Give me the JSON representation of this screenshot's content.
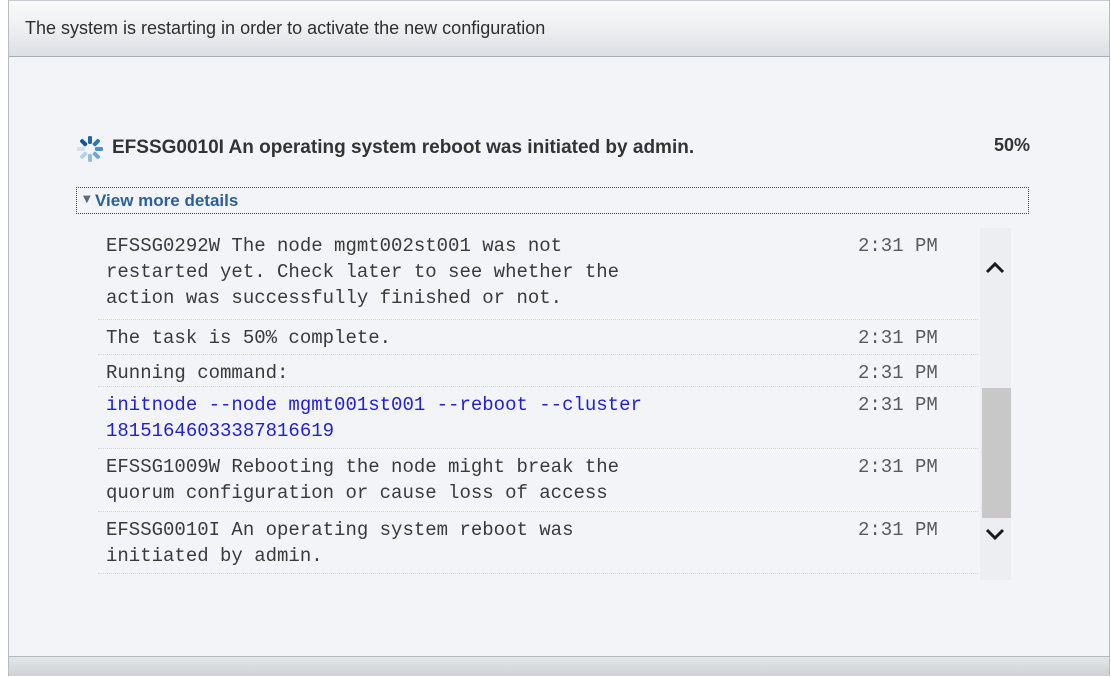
{
  "dialog": {
    "title": "The system is restarting in order to activate the new configuration"
  },
  "status": {
    "icon": "spinner-icon",
    "message": "EFSSG0010I An operating system reboot was initiated by admin.",
    "progress_label": "50%",
    "progress": 0.5
  },
  "details": {
    "toggle_label": "View more details",
    "toggle_icon": "triangle-down-icon",
    "entries": [
      {
        "message": "EFSSG0292W The node mgmt002st001 was not\nrestarted yet. Check later to see whether the\naction was successfully finished or not.",
        "time": "2:31 PM",
        "kind": "text"
      },
      {
        "message": "The task is 50% complete.",
        "time": "2:31 PM",
        "kind": "text"
      },
      {
        "message": "Running command:",
        "time": "2:31 PM",
        "kind": "text"
      },
      {
        "message": "initnode --node mgmt001st001 --reboot --cluster\n18151646033387816619",
        "time": "2:31 PM",
        "kind": "command"
      },
      {
        "message": "EFSSG1009W Rebooting the node might break the\nquorum configuration or cause loss of access",
        "time": "2:31 PM",
        "kind": "text"
      },
      {
        "message": "EFSSG0010I An operating system reboot was\ninitiated by admin.",
        "time": "2:31 PM",
        "kind": "text"
      }
    ]
  },
  "colors": {
    "link": "#2f5f98",
    "command": "#1f1fd6",
    "panel_bg": "#f2f4f7"
  }
}
